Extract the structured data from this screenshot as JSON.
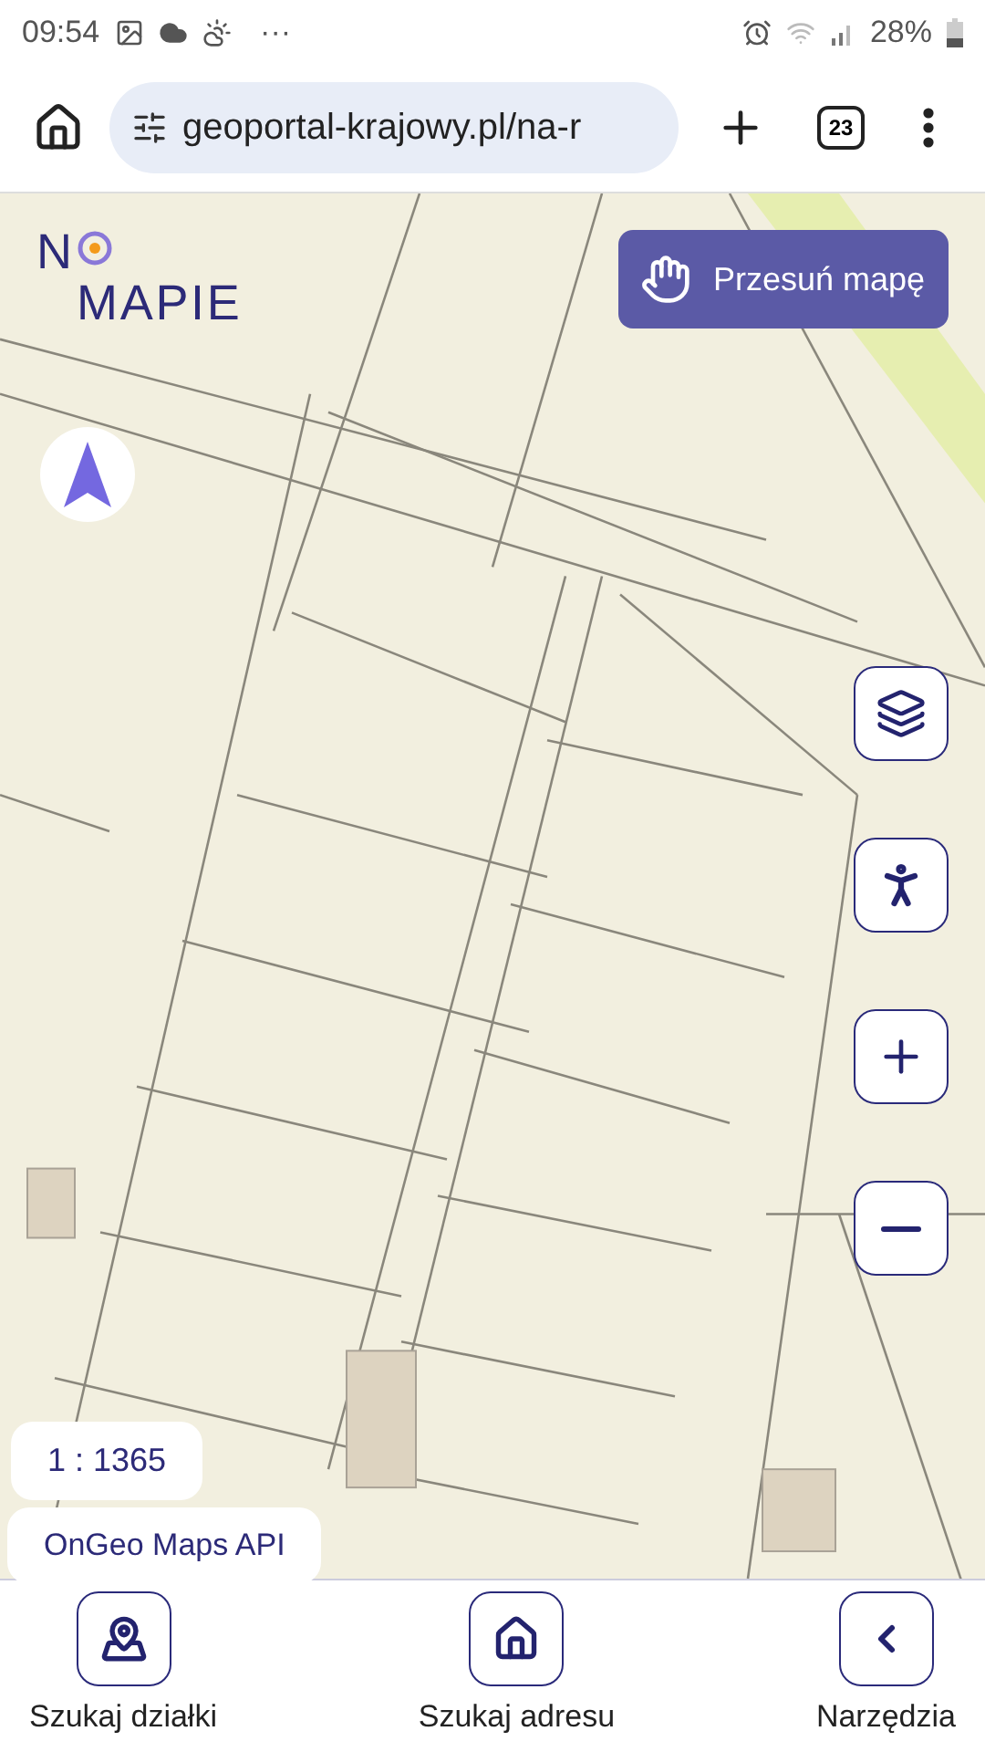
{
  "status_bar": {
    "time": "09:54",
    "overflow": "···",
    "battery": "28%"
  },
  "browser": {
    "url": "geoportal-krajowy.pl/na-r",
    "tab_count": "23"
  },
  "map": {
    "logo": {
      "first": "N",
      "second": "MAPIE"
    },
    "pan_button": "Przesuń mapę",
    "scale": "1 : 1365",
    "attribution": "OnGeo Maps API"
  },
  "bottom_nav": [
    {
      "kind": "parcel",
      "label": "Szukaj działki"
    },
    {
      "kind": "address",
      "label": "Szukaj adresu"
    },
    {
      "kind": "tools",
      "label": "Narzędzia"
    }
  ]
}
